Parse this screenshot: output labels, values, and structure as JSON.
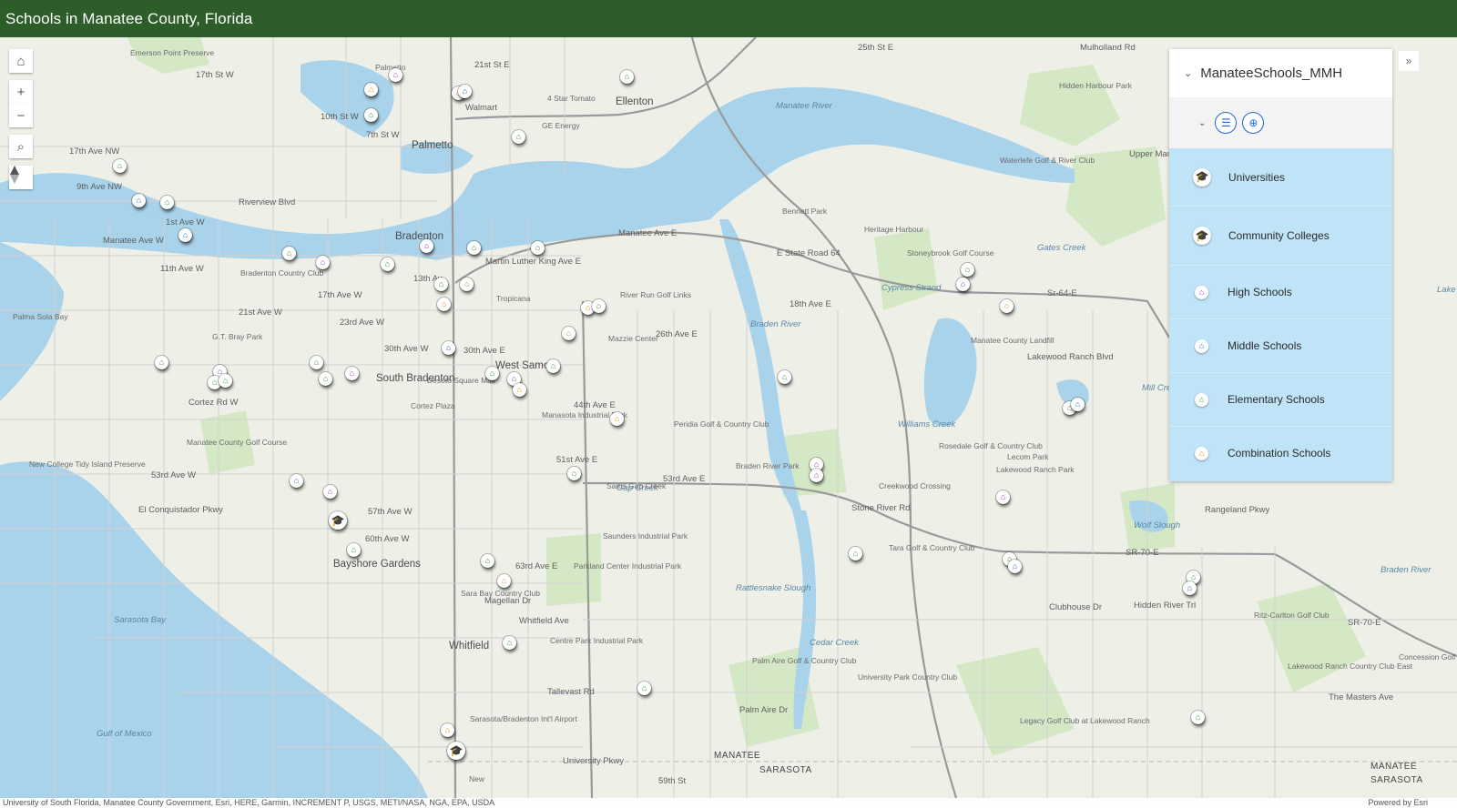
{
  "header": {
    "title": "Schools in Manatee County, Florida"
  },
  "map": {
    "controls": {
      "home_icon": "⌂",
      "zoom_in": "+",
      "zoom_out": "−",
      "search_icon": "⌕",
      "compass_icon": "compass-icon"
    },
    "labels": {
      "emerson": "Emerson Point Preserve",
      "palmetto_small": "Palmetto",
      "st21e": "21st St E",
      "st25e": "25th St E",
      "mulholland": "Mulholland Rd",
      "st17w": "17th St W",
      "st10w": "10th St W",
      "st7w": "7th St W",
      "walmart": "Walmart",
      "fourstar": "4 Star Tomato",
      "ge": "GE Energy",
      "ellenton": "Ellenton",
      "palmetto": "Palmetto",
      "hidden_harbour": "Hidden Harbour Park",
      "av17nw": "17th Ave NW",
      "av9nw": "9th Ave NW",
      "riverview": "Riverview Blvd",
      "waterlefe": "Waterlefe Golf & River Club",
      "upper_manatee": "Upper Manatee",
      "manatee_river": "Manatee River",
      "av1w": "1st Ave W",
      "manatee_ave_w": "Manatee Ave W",
      "bradenton": "Bradenton",
      "manatee_ave_e": "Manatee Ave E",
      "mlk": "Martin Luther King Ave E",
      "bennett": "Bennett Park",
      "heritage": "Heritage Harbour",
      "state_road": "E State Road 64",
      "stoneybrook": "Stoneybrook Golf Course",
      "cypress": "Cypress Strand",
      "sr64e": "Sr-64-E",
      "av11w": "11th Ave W",
      "bcc": "Bradenton Country Club",
      "av13w": "13th Av",
      "av17w": "17th Ave W",
      "tropicana": "Tropicana",
      "river_run": "River Run Golf Links",
      "av18e": "18th Ave E",
      "av21w": "21st Ave W",
      "av23w": "23rd Ave W",
      "palma": "Palma Sola Bay",
      "mazzie": "Mazzie Center",
      "av26e": "26th Ave E",
      "av30w": "30th Ave W",
      "av30e": "30th Ave E",
      "west_samo": "West Samo",
      "landfill": "Manatee County Landfill",
      "gt_bray": "G.T. Bray Park",
      "south_brad": "South Bradenton",
      "desoto": "Desoto Square Mall",
      "cortez_rd": "Cortez Rd W",
      "cortez_plaza": "Cortez Plaza",
      "av44e": "44th Ave E",
      "mip": "Manasota Industrial Park",
      "perida": "Peridia Golf & Country Club",
      "williams": "Williams Creek",
      "mcgc": "Manatee County Golf Course",
      "rosedale": "Rosedale Golf & Country Club",
      "lecom": "Lecom Park",
      "lwr_park": "Lakewood Ranch Park",
      "new_college": "New College Tidy Island Preserve",
      "av53w": "53rd Ave W",
      "st51e": "51st Ave E",
      "av53e": "53rd Ave E",
      "gap_creek": "Gap Creek",
      "braden_river_park": "Braden River Park",
      "creekwood": "Creekwood Crossing",
      "stone_river": "Stone River Rd",
      "rangeland": "Rangeland Pkwy",
      "wolf_slough": "Wolf Slough",
      "el_conq": "El Conquistador Pkwy",
      "av57w": "57th Ave W",
      "av60w": "60th Ave W",
      "sams": "Sams Gap Creek",
      "saunders": "Saunders Industrial Park",
      "sr70e": "SR-70-E",
      "braden_river": "Braden River",
      "bayshore": "Bayshore Gardens",
      "av63e": "63rd Ave E",
      "parkland": "Parkland Center Industrial Park",
      "tara": "Tara Golf & Country Club",
      "rattlesnake": "Rattlesnake Slough",
      "clubhouse": "Clubhouse Dr",
      "hidden_river": "Hidden River Trl",
      "sara_bay_cc": "Sara Bay Country Club",
      "magellan": "Magellan Dr",
      "sarasota_bay": "Sarasota Bay",
      "whitfield_ave": "Whitfield Ave",
      "ritz": "Ritz-Carlton Golf Club",
      "sr70e2": "SR-70-E",
      "whitfield": "Whitfield",
      "cpip": "Centre Park Industrial Park",
      "palm_aire": "Palm Aire Golf & Country Club",
      "upcc": "University Park Country Club",
      "lwr_east": "Lakewood Ranch Country Club East",
      "concession": "Concession Golf Course",
      "tallevast": "Tallevast Rd",
      "masters": "The Masters Ave",
      "palm_aire_dr": "Palm Aire Dr",
      "legacy": "Legacy Golf Club at Lakewood Ranch",
      "airport": "Sarasota/Bradenton Int'l Airport",
      "gulf": "Gulf of Mexico",
      "univ_pkwy": "University Pkwy",
      "manatee": "MANATEE",
      "sarasota": "SARASOTA",
      "manatee2": "MANATEE",
      "sarasota2": "SARASOTA",
      "new": "New",
      "st59": "59th St",
      "lake": "Lake",
      "mill_creek": "Mill Creek",
      "gates_creek": "Gates Creek",
      "cedar_creek": "Cedar Creek",
      "braden_river_v": "Braden River",
      "lakewood_ranch_blvd": "Lakewood Ranch Blvd"
    }
  },
  "legend": {
    "layer_title": "ManateeSchools_MMH",
    "collapse_icon": "»",
    "items": [
      {
        "label": "Universities",
        "icon": "graduation-cap-icon",
        "color": "#c8161d"
      },
      {
        "label": "Community Colleges",
        "icon": "graduation-cap-icon",
        "color": "#1f5fc6"
      },
      {
        "label": "High Schools",
        "icon": "school-building-icon",
        "color": "#9a3fb5"
      },
      {
        "label": "Middle Schools",
        "icon": "school-building-icon",
        "color": "#2f6fc4"
      },
      {
        "label": "Elementary Schools",
        "icon": "school-building-icon",
        "color": "#3e9a34"
      },
      {
        "label": "Combination Schools",
        "icon": "school-building-icon",
        "color": "#e3941f"
      }
    ]
  },
  "attribution": {
    "credits": "University of South Florida, Manatee County Government, Esri, HERE, Garmin, INCREMENT P, USGS, METI/NASA, NGA, EPA, USDA",
    "powered": "Powered by Esri"
  }
}
